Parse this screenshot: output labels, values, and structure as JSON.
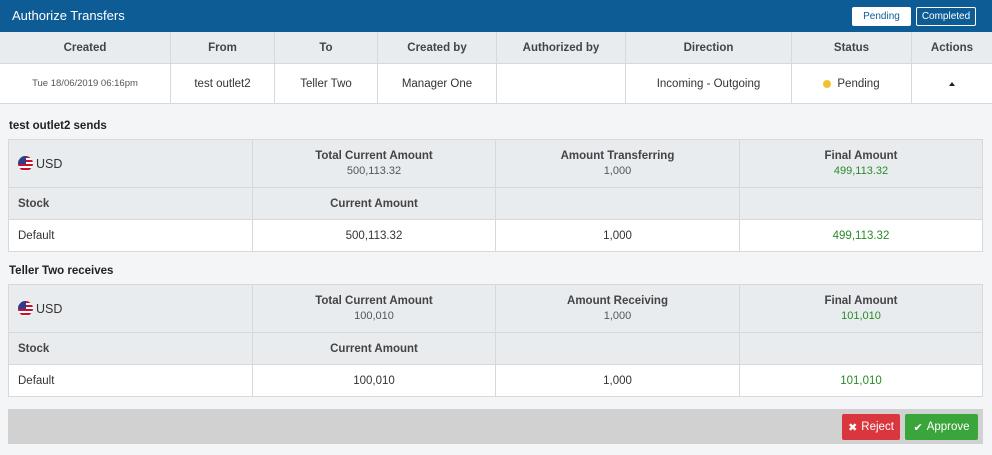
{
  "header": {
    "title": "Authorize Transfers",
    "tabs": {
      "pending": "Pending",
      "completed": "Completed"
    }
  },
  "columns": [
    "Created",
    "From",
    "To",
    "Created by",
    "Authorized by",
    "Direction",
    "Status",
    "Actions"
  ],
  "transfer": {
    "created": "Tue 18/06/2019 06:16pm",
    "from": "test outlet2",
    "to": "Teller Two",
    "created_by": "Manager One",
    "authorized_by": "",
    "direction": "Incoming - Outgoing",
    "status": "Pending",
    "status_color": "#f2c12e",
    "action_icon": "caret-up-icon"
  },
  "sender": {
    "title": "test outlet2 sends",
    "currency": "USD",
    "currency_icon": "us-flag-icon",
    "total_label": "Total Current Amount",
    "total_value": "500,113.32",
    "transfer_label": "Amount Transferring",
    "transfer_value": "1,000",
    "final_label": "Final Amount",
    "final_value": "499,113.32",
    "stock_label": "Stock",
    "current_label": "Current Amount",
    "row": {
      "stock": "Default",
      "current": "500,113.32",
      "amount": "1,000",
      "final": "499,113.32"
    }
  },
  "receiver": {
    "title": "Teller Two receives",
    "currency": "USD",
    "currency_icon": "us-flag-icon",
    "total_label": "Total Current Amount",
    "total_value": "100,010",
    "transfer_label": "Amount Receiving",
    "transfer_value": "1,000",
    "final_label": "Final Amount",
    "final_value": "101,010",
    "stock_label": "Stock",
    "current_label": "Current Amount",
    "row": {
      "stock": "Default",
      "current": "100,010",
      "amount": "1,000",
      "final": "101,010"
    }
  },
  "actions": {
    "reject": "Reject",
    "approve": "Approve"
  },
  "colors": {
    "header_bg": "#0d5c96",
    "reject": "#d9363e",
    "approve": "#3aa53a",
    "final_amount": "#2a8a2a"
  }
}
